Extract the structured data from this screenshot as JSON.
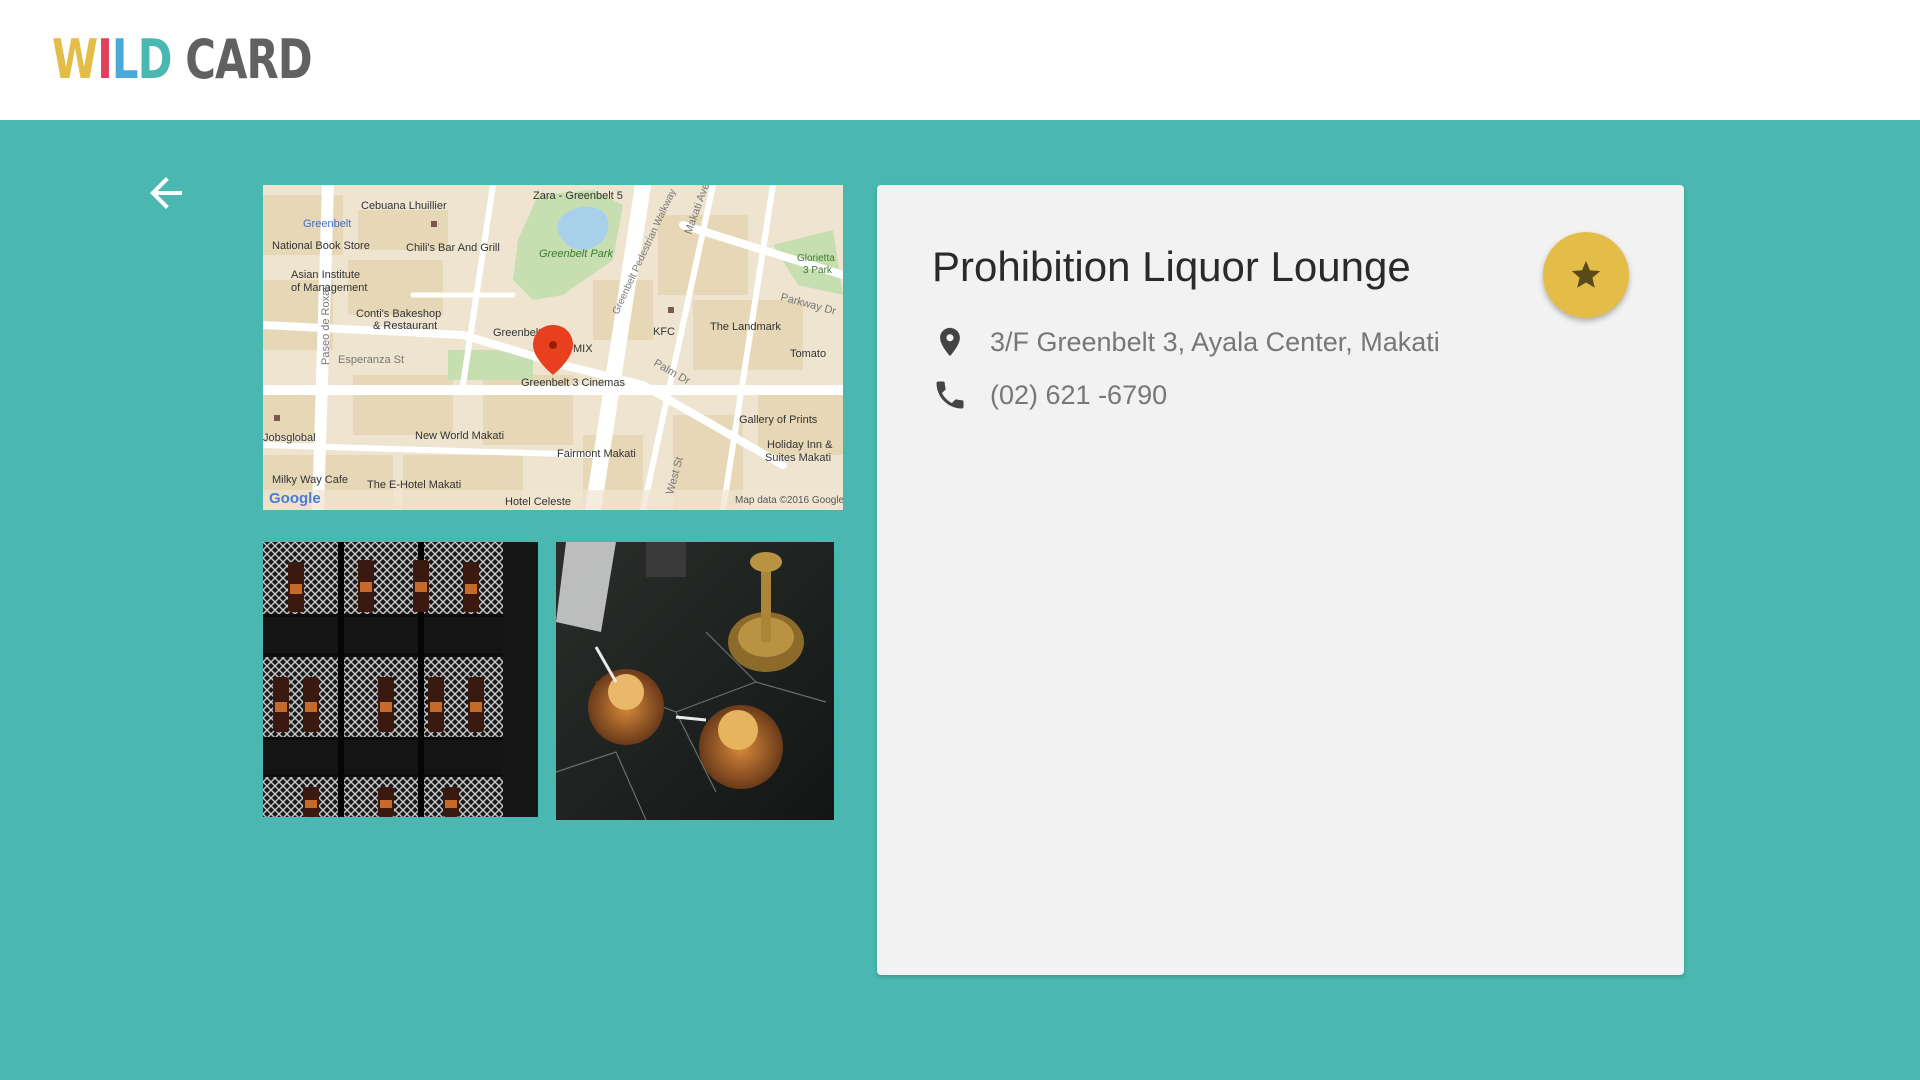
{
  "header": {
    "logo_letters": [
      {
        "char": "W",
        "color": "#e3bd48"
      },
      {
        "char": "I",
        "color": "#e0405a"
      },
      {
        "char": "L",
        "color": "#4aa9d8"
      },
      {
        "char": "D",
        "color": "#4ab8b0"
      },
      {
        "char": " ",
        "color": "#666666"
      },
      {
        "char": "C",
        "color": "#616161"
      },
      {
        "char": "A",
        "color": "#616161"
      },
      {
        "char": "R",
        "color": "#616161"
      },
      {
        "char": "D",
        "color": "#616161"
      }
    ]
  },
  "navigation": {
    "back_icon": "arrow-left-icon"
  },
  "map": {
    "attribution": "Map data ©2016 Google",
    "brand": "Google",
    "labels": [
      "Cebuana Lhuillier",
      "Zara - Greenbelt 5",
      "Greenbelt",
      "National Book Store",
      "Chili's Bar And Grill",
      "Greenbelt Park",
      "Asian Institute",
      "of Management",
      "Conti's Bakeshop",
      "& Restaurant",
      "Greenbelt",
      "KFC",
      "The Landmark",
      "Tomato",
      "Esperanza St",
      "MIX",
      "Greenbelt 3 Cinemas",
      "Paseo de Roxas",
      "Gallery of Prints",
      "Holiday Inn &",
      "Suites Makati",
      "Jobsglobal",
      "New World Makati",
      "Fairmont Makati",
      "Milky Way Cafe",
      "The E-Hotel Makati",
      "Hotel Celeste",
      "Glorietta",
      "3 Park",
      "Parkway Dr",
      "Palm Dr",
      "West St",
      "Greenbelt Pedestrian Walkway",
      "Makati Ave"
    ]
  },
  "photos": [
    {
      "name": "bottles-display-photo"
    },
    {
      "name": "cocktails-photo"
    }
  ],
  "venue": {
    "name": "Prohibition Liquor Lounge",
    "address": "3/F Greenbelt 3, Ayala Center, Makati",
    "phone": "(02) 621 -6790",
    "favorite_icon": "star-icon",
    "address_icon": "location-pin-icon",
    "phone_icon": "phone-icon"
  },
  "colors": {
    "background": "#4ab8b0",
    "card": "#f2f2f2",
    "favorite": "#e3bd48",
    "pin": "#e8401f"
  }
}
